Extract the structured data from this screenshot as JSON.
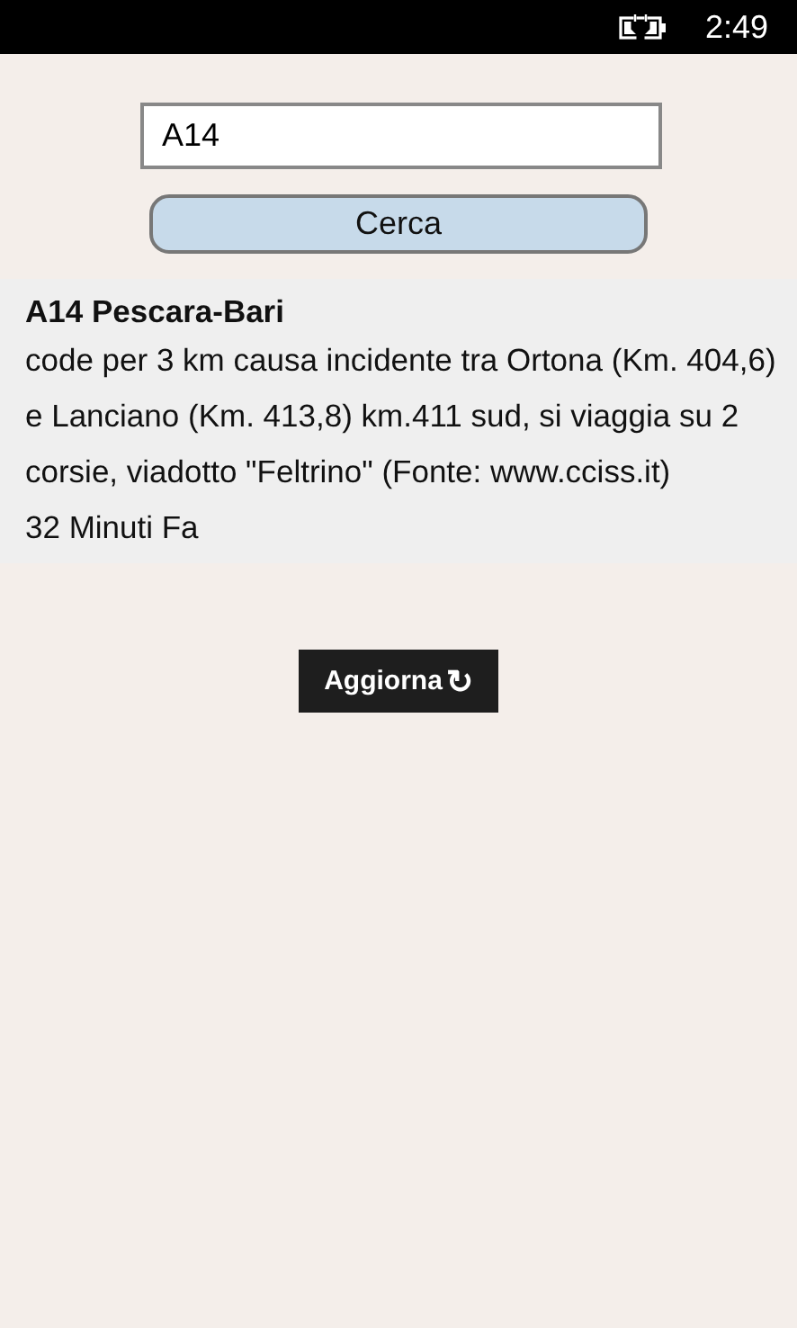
{
  "status_bar": {
    "time": "2:49",
    "charging": true
  },
  "search": {
    "value": "A14"
  },
  "search_button": {
    "label": "Cerca"
  },
  "results": [
    {
      "title": "A14 Pescara-Bari",
      "description": "code per 3 km causa incidente tra Ortona (Km. 404,6) e Lanciano (Km. 413,8) km.411 sud, si viaggia su 2 corsie, viadotto \"Feltrino\" (Fonte: www.cciss.it)",
      "age": "32 Minuti Fa"
    }
  ],
  "refresh_button": {
    "label": "Aggiorna",
    "icon": "↻"
  }
}
